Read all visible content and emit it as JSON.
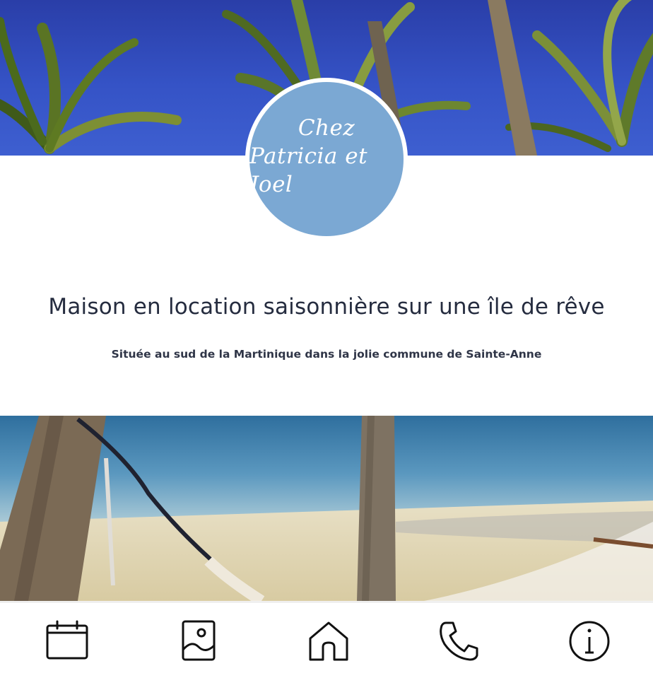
{
  "brand": {
    "line1": "Chez",
    "line2": "Patricia et Joel",
    "circle_color": "#7ba8d3"
  },
  "intro": {
    "headline": "Maison en location saisonnière sur une île de rêve",
    "subline": "Située au sud de la Martinique dans la jolie commune de Sainte-Anne"
  },
  "tabbar": {
    "items": [
      {
        "icon": "calendar-icon"
      },
      {
        "icon": "gallery-icon"
      },
      {
        "icon": "home-icon"
      },
      {
        "icon": "phone-icon"
      },
      {
        "icon": "info-icon"
      }
    ]
  }
}
